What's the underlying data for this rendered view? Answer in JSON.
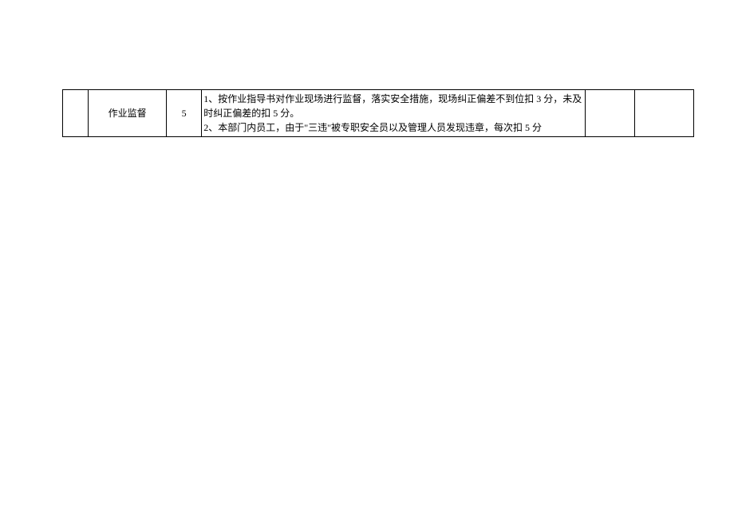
{
  "table": {
    "row": {
      "col1": "",
      "col2": "作业监督",
      "col3": "5",
      "col4": "1、按作业指导书对作业现场进行监督，落实安全措施，现场纠正偏差不到位扣 3 分，未及时纠正偏差的扣 5 分。\n2、本部门内员工，由于\"三违\"被专职安全员以及管理人员发现违章，每次扣 5 分",
      "col5": "",
      "col6": ""
    }
  }
}
